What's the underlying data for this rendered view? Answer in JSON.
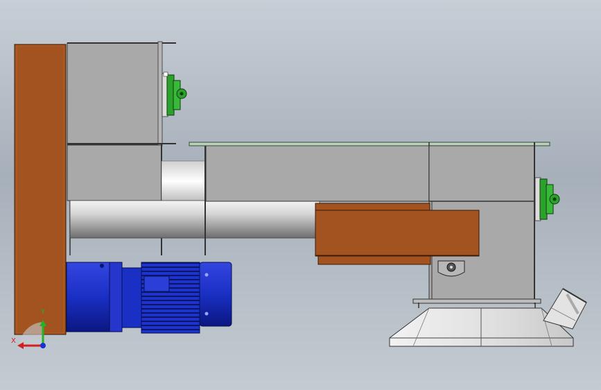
{
  "triad": {
    "x_label": "X",
    "y_label": "Y",
    "colors": {
      "x": "#d31f1f",
      "y": "#23b323",
      "z": "#1f2fd3"
    }
  },
  "colors": {
    "background_top": "#c7ced6",
    "background_bottom": "#a7b0ba",
    "housing": "#a9a9a9",
    "frame_panel": "#a0522d",
    "motor": "#1a2fc4",
    "bearing": "#2ca22c",
    "hopper": "#dcdcdc"
  },
  "icons": [
    "view-triad-icon"
  ]
}
